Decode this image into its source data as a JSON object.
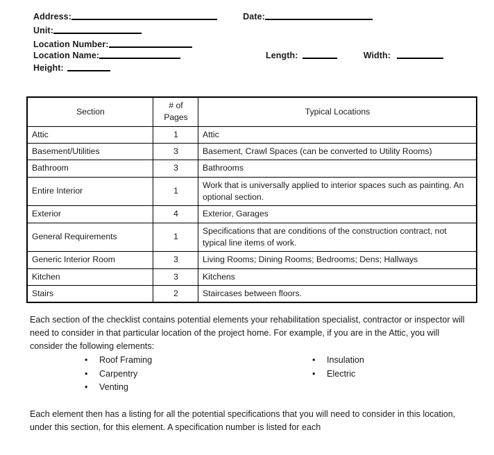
{
  "form": {
    "fields": [
      {
        "label": "Address:",
        "value": "",
        "line_width": 210
      },
      {
        "label": "Date:",
        "value": "",
        "line_width": 155
      },
      {
        "label": "Unit:",
        "value": "",
        "line_width": 127
      },
      {
        "label": "Location Number:",
        "value": "",
        "line_width": 120
      },
      {
        "label": "Location Name:",
        "value": "",
        "line_width": 117
      },
      {
        "label": "Length:",
        "value": "",
        "line_width": 50
      },
      {
        "label": "Width:",
        "value": "",
        "line_width": 67
      },
      {
        "label": "Height:",
        "value": "",
        "line_width": 62
      }
    ],
    "address_label": "Address:",
    "date_label": "Date:",
    "unit_label": "Unit:",
    "location_number_label": "Location Number:",
    "location_name_label": "Location Name:",
    "length_label": "Length:",
    "width_label": "Width:",
    "height_label": "Height:"
  },
  "table": {
    "headers": {
      "section": "Section",
      "pages_line1": "# of",
      "pages_line2": "Pages",
      "locations": "Typical Locations"
    },
    "rows": [
      {
        "section": "Attic",
        "pages": "1",
        "locations": "Attic",
        "multiline": false
      },
      {
        "section": "Basement/Utilities",
        "pages": "3",
        "locations": "Basement, Crawl Spaces (can be converted to Utility Rooms)",
        "multiline": true
      },
      {
        "section": "Bathroom",
        "pages": "3",
        "locations": "Bathrooms",
        "multiline": false
      },
      {
        "section": "Entire Interior",
        "pages": "1",
        "locations": "Work that is universally applied to interior spaces such as painting.  An optional section.",
        "multiline": true
      },
      {
        "section": "Exterior",
        "pages": "4",
        "locations": "Exterior, Garages",
        "multiline": false
      },
      {
        "section": "General Requirements",
        "pages": "1",
        "locations": "Specifications that are conditions of the construction contract, not typical line items of work.",
        "multiline": true
      },
      {
        "section": "Generic Interior Room",
        "pages": "3",
        "locations": "Living Rooms; Dining Rooms; Bedrooms; Dens; Hallways",
        "multiline": false
      },
      {
        "section": "Kitchen",
        "pages": "3",
        "locations": "Kitchens",
        "multiline": false
      },
      {
        "section": "Stairs",
        "pages": "2",
        "locations": "Staircases between floors.",
        "multiline": false
      }
    ]
  },
  "body": {
    "intro_paragraph": "Each section of the checklist contains potential elements your rehabilitation specialist, contractor or inspector will need to consider in that particular location of the project home. For example, if you are in the Attic, you will consider the following elements:",
    "bullets_left": [
      "Roof Framing",
      "Carpentry",
      "Venting"
    ],
    "bullets_right": [
      "Insulation",
      "Electric"
    ],
    "bullet_glyph": "•",
    "outro_paragraph": "Each element then has a listing for all the potential specifications that you will need to consider in this location, under this section, for this element. A specification number is listed for each"
  }
}
